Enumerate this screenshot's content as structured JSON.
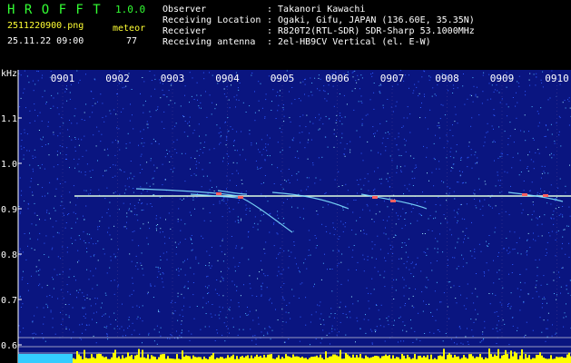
{
  "app": {
    "name": "H R O F F T",
    "version": "1.0.0",
    "filename": "2511220900.png",
    "datetime": "25.11.22 09:00",
    "mode": "meteor",
    "count": "77"
  },
  "info": {
    "labels": [
      "Observer",
      "Receiving Location",
      "Receiver",
      "Receiving antenna"
    ],
    "values": [
      ": Takanori Kawachi",
      ": Ogaki, Gifu, JAPAN (136.60E, 35.35N)",
      ": R820T2(RTL-SDR) SDR-Sharp 53.1000MHz",
      ": 2el-HB9CV Vertical (el. E-W)"
    ]
  },
  "spectrogram": {
    "unit": "kHz",
    "time_labels": [
      "0901",
      "0902",
      "0903",
      "0904",
      "0905",
      "0906",
      "0907",
      "0908",
      "0909",
      "0910"
    ],
    "freq_labels": [
      "1.1",
      "1.0",
      "0.9",
      "0.8",
      "0.7",
      "0.6"
    ],
    "carrier_khz": 0.92,
    "colors": {
      "background": "#0a1580",
      "dots": "#2e66ff",
      "grid": "#d0d0d0",
      "trace": "#e0ffe0",
      "signal": "#ffff00"
    }
  }
}
